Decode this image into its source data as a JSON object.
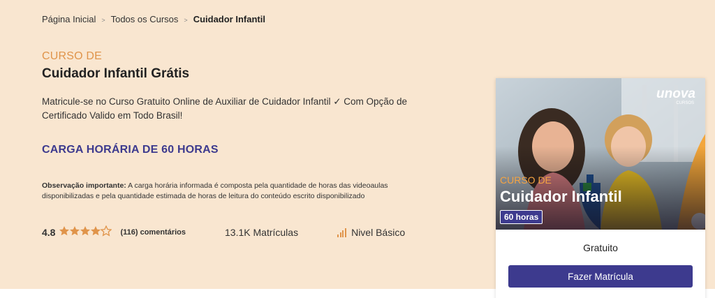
{
  "breadcrumb": {
    "home": "Página Inicial",
    "courses": "Todos os Cursos",
    "current": "Cuidador Infantil",
    "separator": ">"
  },
  "course": {
    "kicker": "CURSO DE",
    "title": "Cuidador Infantil Grátis",
    "description": "Matricule-se no Curso Gratuito Online de Auxiliar de Cuidador Infantil ✓ Com Opção de Certificado Valido em Todo Brasil!",
    "hours": "CARGA HORÁRIA DE 60 HORAS",
    "obs_label": "Observação importante:",
    "obs_text": " A carga horária informada é composta pela quantidade de horas das videoaulas disponibilizadas e pela quantidade estimada de horas de leitura do conteúdo escrito disponibilizado"
  },
  "stats": {
    "rating": "4.8",
    "stars_shown": 4.5,
    "reviews": "(116) comentários",
    "enrollments": "13.1K Matrículas",
    "level": "Nivel Básico"
  },
  "card": {
    "image_kicker": "CURSO DE",
    "image_title": "Cuidador Infantil",
    "image_badge": "60 horas",
    "logo": "unova",
    "logo_sub": "CURSOS",
    "price": "Gratuito",
    "cta_label": "Fazer Matrícula"
  },
  "colors": {
    "hero_bg": "#f9e6d0",
    "accent_orange": "#e0944a",
    "brand_indigo": "#3d3a8e"
  },
  "icons": {
    "star": "star-icon",
    "level": "signal-bars-icon",
    "separator": "chevron-right-icon"
  }
}
